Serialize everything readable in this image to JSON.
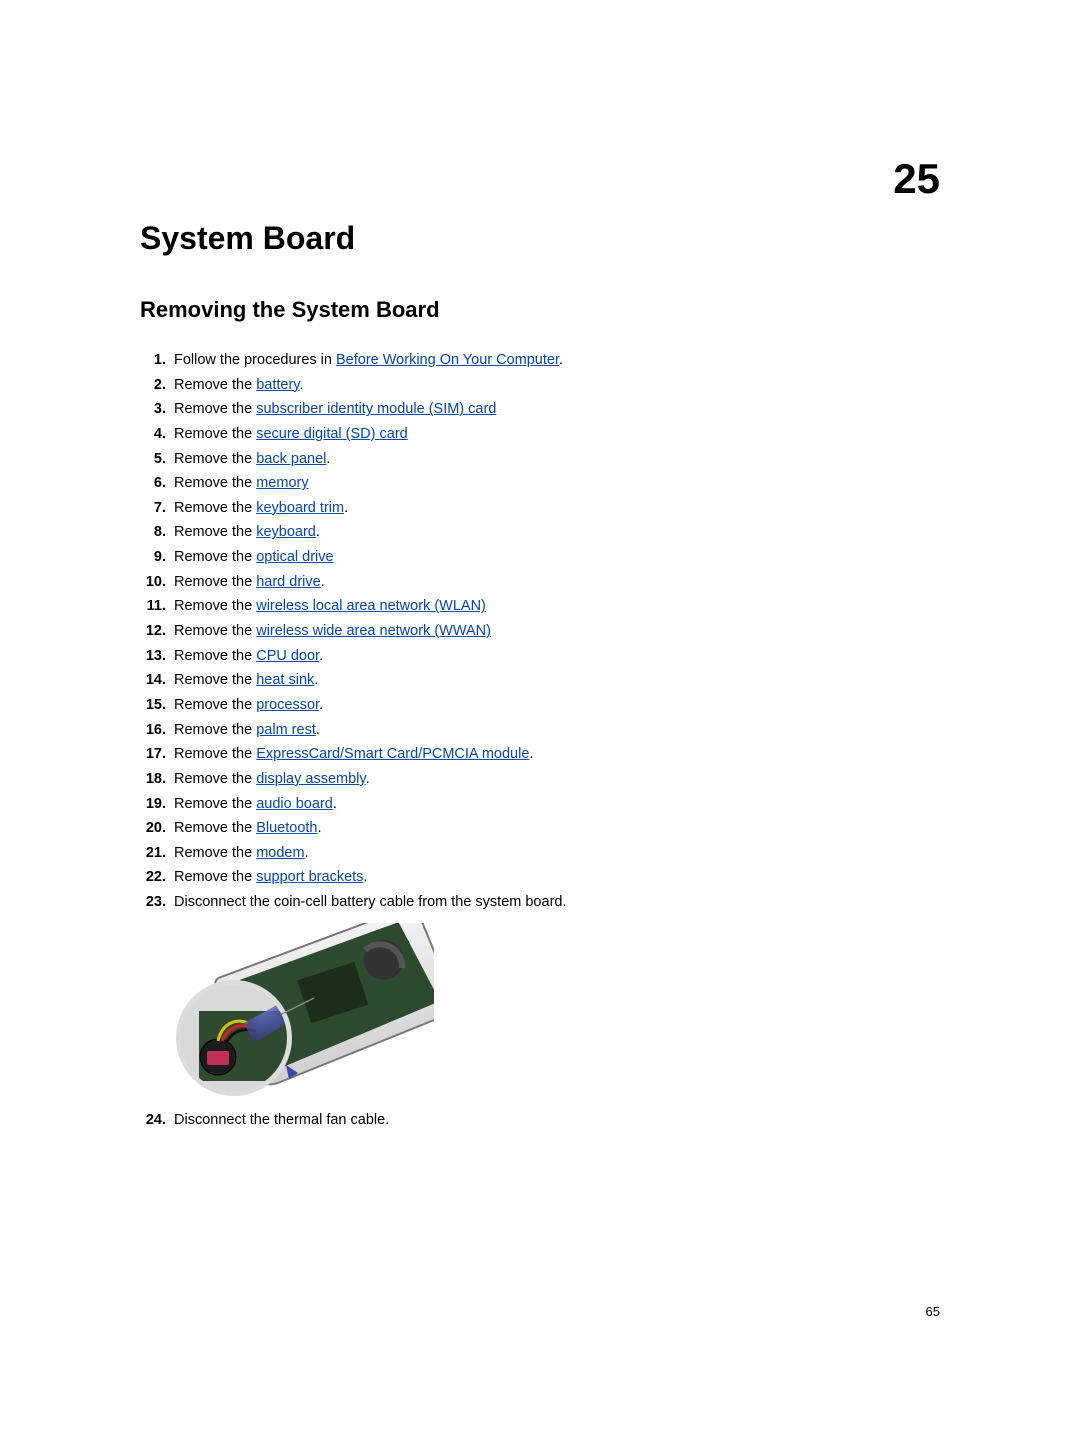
{
  "chapter_number": "25",
  "chapter_title": "System Board",
  "section_title": "Removing the System Board",
  "page_number": "65",
  "steps": [
    {
      "pre": "Follow the procedures in ",
      "link": "Before Working On Your Computer",
      "post": "."
    },
    {
      "pre": "Remove the ",
      "link": "battery",
      "post": "."
    },
    {
      "pre": "Remove the ",
      "link": "subscriber identity module (SIM) card",
      "post": ""
    },
    {
      "pre": "Remove the ",
      "link": "secure digital (SD) card",
      "post": ""
    },
    {
      "pre": "Remove the ",
      "link": "back panel",
      "post": "."
    },
    {
      "pre": "Remove the ",
      "link": "memory",
      "post": ""
    },
    {
      "pre": "Remove the ",
      "link": "keyboard trim",
      "post": "."
    },
    {
      "pre": "Remove the ",
      "link": "keyboard",
      "post": "."
    },
    {
      "pre": "Remove the ",
      "link": "optical drive",
      "post": ""
    },
    {
      "pre": "Remove the ",
      "link": "hard drive",
      "post": "."
    },
    {
      "pre": "Remove the ",
      "link": "wireless local area network (WLAN)",
      "post": ""
    },
    {
      "pre": "Remove the ",
      "link": "wireless wide area network (WWAN)",
      "post": ""
    },
    {
      "pre": "Remove the ",
      "link": "CPU door",
      "post": "."
    },
    {
      "pre": "Remove the ",
      "link": "heat sink",
      "post": "."
    },
    {
      "pre": "Remove the ",
      "link": "processor",
      "post": "."
    },
    {
      "pre": "Remove the ",
      "link": "palm rest",
      "post": "."
    },
    {
      "pre": "Remove the ",
      "link": "ExpressCard/Smart Card/PCMCIA module",
      "post": "."
    },
    {
      "pre": "Remove the ",
      "link": "display assembly",
      "post": "."
    },
    {
      "pre": "Remove the ",
      "link": "audio board",
      "post": "."
    },
    {
      "pre": "Remove the ",
      "link": "Bluetooth",
      "post": "."
    },
    {
      "pre": "Remove the ",
      "link": "modem",
      "post": "."
    },
    {
      "pre": "Remove the ",
      "link": "support brackets",
      "post": "."
    },
    {
      "pre": "Disconnect the coin-cell battery cable from the system board.",
      "link": "",
      "post": "",
      "figure_after": true
    },
    {
      "pre": "Disconnect the thermal fan cable.",
      "link": "",
      "post": ""
    }
  ]
}
